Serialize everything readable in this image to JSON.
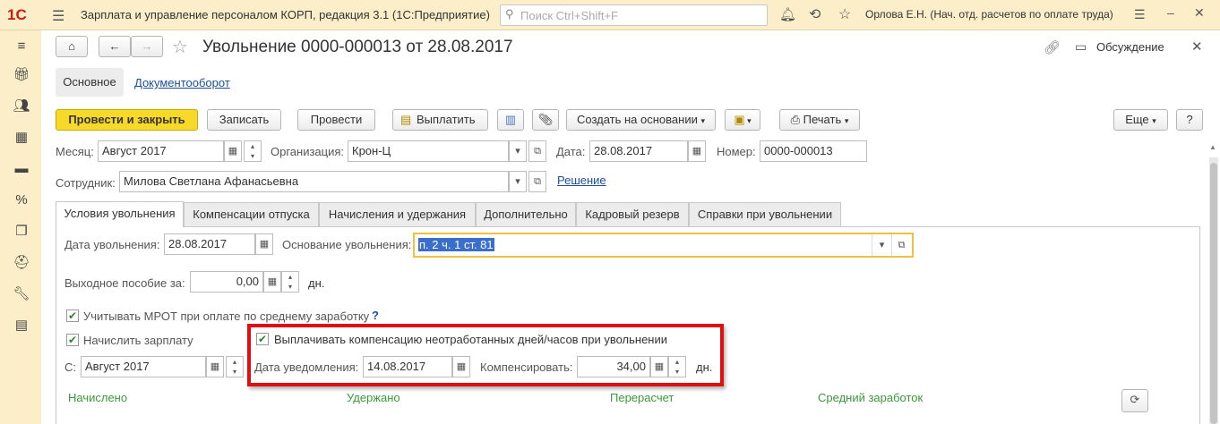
{
  "app": {
    "logo": "1С",
    "title": "Зарплата и управление персоналом КОРП, редакция 3.1  (1С:Предприятие)",
    "search_placeholder": "Поиск Ctrl+Shift+F",
    "user": "Орлова Е.Н. (Нач. отд. расчетов по оплате труда)"
  },
  "doc": {
    "title": "Увольнение 0000-000013 от 28.08.2017",
    "discuss": "Обсуждение"
  },
  "nav": {
    "main": "Основное",
    "docflow": "Документооборот"
  },
  "toolbar": {
    "post_close": "Провести и закрыть",
    "save": "Записать",
    "post": "Провести",
    "pay": "Выплатить",
    "create_based": "Создать на основании",
    "print": "Печать",
    "more": "Еще",
    "help": "?"
  },
  "form": {
    "month_label": "Месяц:",
    "month_value": "Август 2017",
    "org_label": "Организация:",
    "org_value": "Крон-Ц",
    "date_label": "Дата:",
    "date_value": "28.08.2017",
    "number_label": "Номер:",
    "number_value": "0000-000013",
    "employee_label": "Сотрудник:",
    "employee_value": "Милова Светлана Афанасьевна",
    "decision_link": "Решение"
  },
  "tabs": [
    "Условия увольнения",
    "Компенсации отпуска",
    "Начисления и удержания",
    "Дополнительно",
    "Кадровый резерв",
    "Справки при увольнении"
  ],
  "conditions": {
    "dismiss_date_label": "Дата увольнения:",
    "dismiss_date": "28.08.2017",
    "basis_label": "Основание увольнения:",
    "basis_value": "п. 2 ч. 1 ст. 81",
    "severance_label": "Выходное пособие за:",
    "severance_value": "0,00",
    "days_unit": "дн.",
    "mrot_label": "Учитывать МРОТ при оплате по среднему заработку",
    "mrot_help": "?",
    "accrue_label": "Начислить зарплату",
    "from_label": "С:",
    "from_value": "Август 2017",
    "compensate_label": "Выплачивать компенсацию неотработанных дней/часов при увольнении",
    "notice_label": "Дата уведомления:",
    "notice_date": "14.08.2017",
    "comp_label": "Компенсировать:",
    "comp_value": "34,00",
    "comp_unit": "дн."
  },
  "sections": {
    "accrued": "Начислено",
    "withheld": "Удержано",
    "recalc": "Перерасчет",
    "avg": "Средний заработок"
  },
  "colors": {
    "accent_yellow": "#f8d92a",
    "highlight_red": "#e01010",
    "green": "#3a9a3a",
    "topbar": "#fbeec8"
  }
}
